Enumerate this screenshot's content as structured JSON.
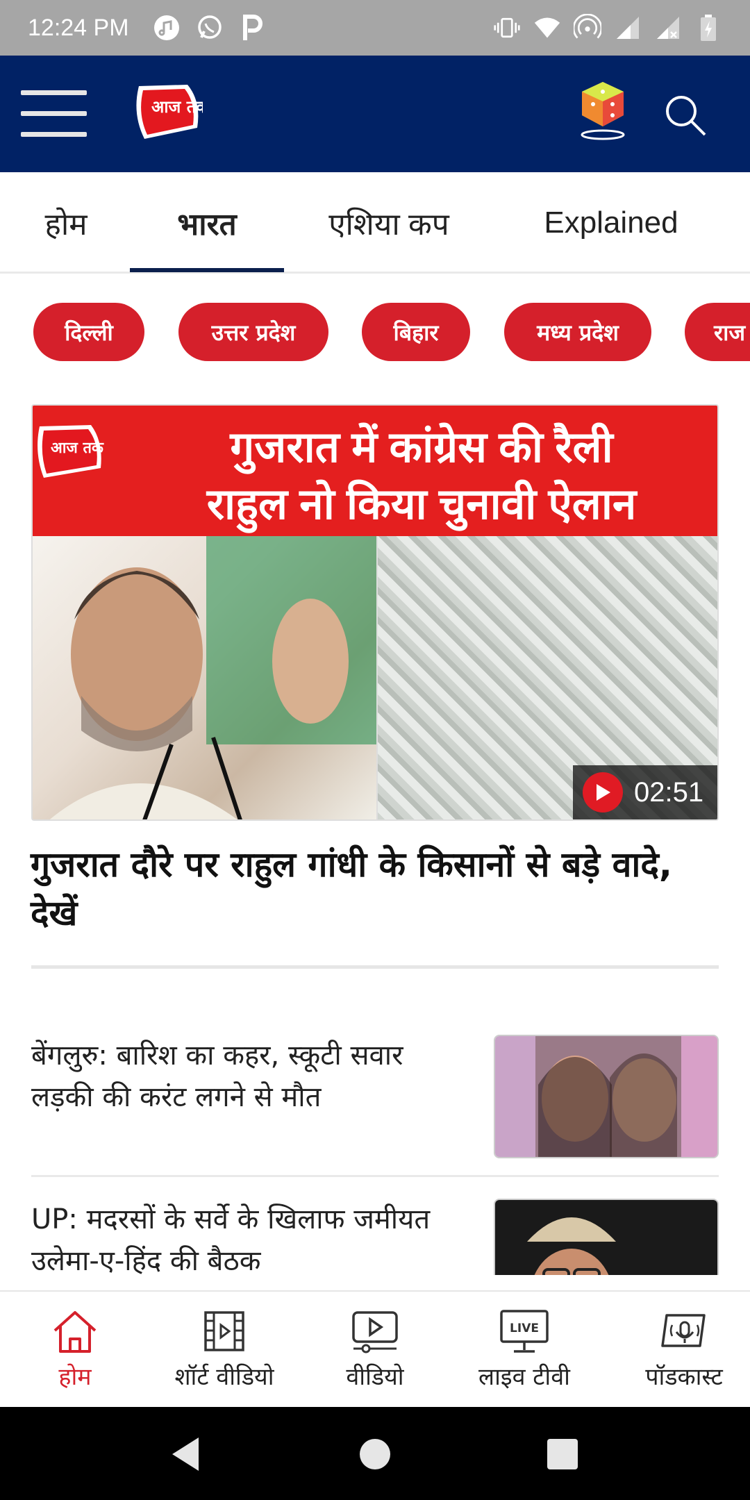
{
  "status_bar": {
    "time": "12:24 PM"
  },
  "header": {
    "logo_text": "आज तक"
  },
  "tabs": [
    {
      "label": "होम"
    },
    {
      "label": "भारत"
    },
    {
      "label": "एशिया कप"
    },
    {
      "label": "Explained"
    }
  ],
  "chips": [
    {
      "label": "दिल्ली"
    },
    {
      "label": "उत्तर प्रदेश"
    },
    {
      "label": "बिहार"
    },
    {
      "label": "मध्य प्रदेश"
    },
    {
      "label": "राज"
    }
  ],
  "hero": {
    "banner_line1": "गुजरात में कांग्रेस की रैली",
    "banner_line2": "राहुल नो किया चुनावी ऐलान",
    "logo_text": "आज तक",
    "duration": "02:51",
    "title": "गुजरात दौरे पर राहुल गांधी के किसानों से बड़े वादे, देखें"
  },
  "stories": [
    {
      "title": "बेंगलुरु: बारिश का कहर, स्कूटी सवार लड़की की करंट लगने से मौत"
    },
    {
      "title": "UP: मदरसों के सर्वे के खिलाफ जमीयत उलेमा-ए-हिंद की बैठक"
    }
  ],
  "bottom_nav": [
    {
      "label": "होम",
      "icon": "home-icon"
    },
    {
      "label": "शॉर्ट वीडियो",
      "icon": "film-icon"
    },
    {
      "label": "वीडियो",
      "icon": "video-icon"
    },
    {
      "label": "लाइव टीवी",
      "icon": "live-tv-icon",
      "badge": "LIVE"
    },
    {
      "label": "पॉडकास्ट",
      "icon": "podcast-icon"
    }
  ],
  "colors": {
    "header_bg": "#012265",
    "accent_red": "#d5202b",
    "status_bar_bg": "#a6a6a6"
  }
}
